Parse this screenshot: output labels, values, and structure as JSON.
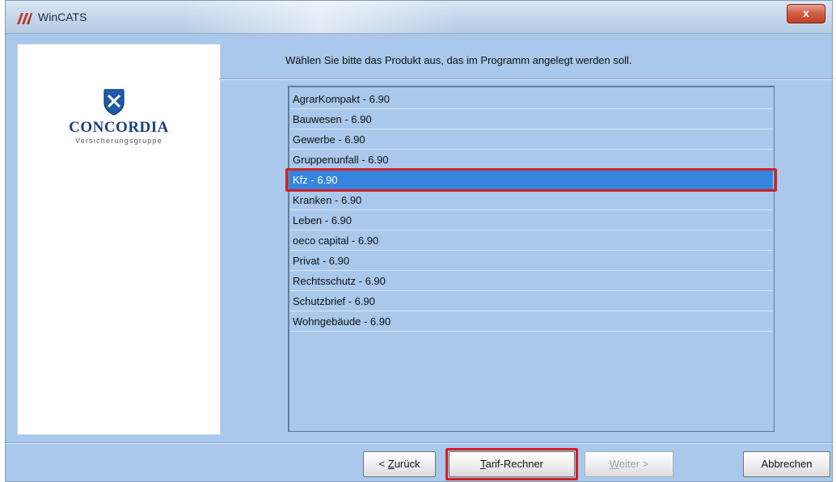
{
  "window": {
    "title": "WinCATS",
    "close_label": "x"
  },
  "logo": {
    "brand": "CONCORDIA",
    "subtitle": "Versicherungsgruppe"
  },
  "instruction": "Wählen Sie bitte das Produkt aus, das im Programm angelegt werden soll.",
  "products": [
    {
      "label": "AgrarKompakt - 6.90"
    },
    {
      "label": "Bauwesen - 6.90"
    },
    {
      "label": "Gewerbe - 6.90"
    },
    {
      "label": "Gruppenunfall - 6.90"
    },
    {
      "label": "Kfz - 6.90",
      "selected": true
    },
    {
      "label": "Kranken - 6.90"
    },
    {
      "label": "Leben - 6.90"
    },
    {
      "label": "oeco capital - 6.90"
    },
    {
      "label": "Privat - 6.90"
    },
    {
      "label": "Rechtsschutz - 6.90"
    },
    {
      "label": "Schutzbrief - 6.90"
    },
    {
      "label": "Wohngebäude - 6.90"
    }
  ],
  "buttons": {
    "back": {
      "prefix": "< ",
      "mnemonic": "Z",
      "rest": "urück"
    },
    "tarif": {
      "mnemonic": "T",
      "rest": "arif-Rechner"
    },
    "next": {
      "mnemonic": "W",
      "rest": "eiter >"
    },
    "cancel": {
      "label": "Abbrechen"
    }
  },
  "colors": {
    "dialog_background": "#a9c8ec",
    "selection": "#3585df",
    "highlight_frame": "#d11f27",
    "brand": "#1d3d87"
  }
}
